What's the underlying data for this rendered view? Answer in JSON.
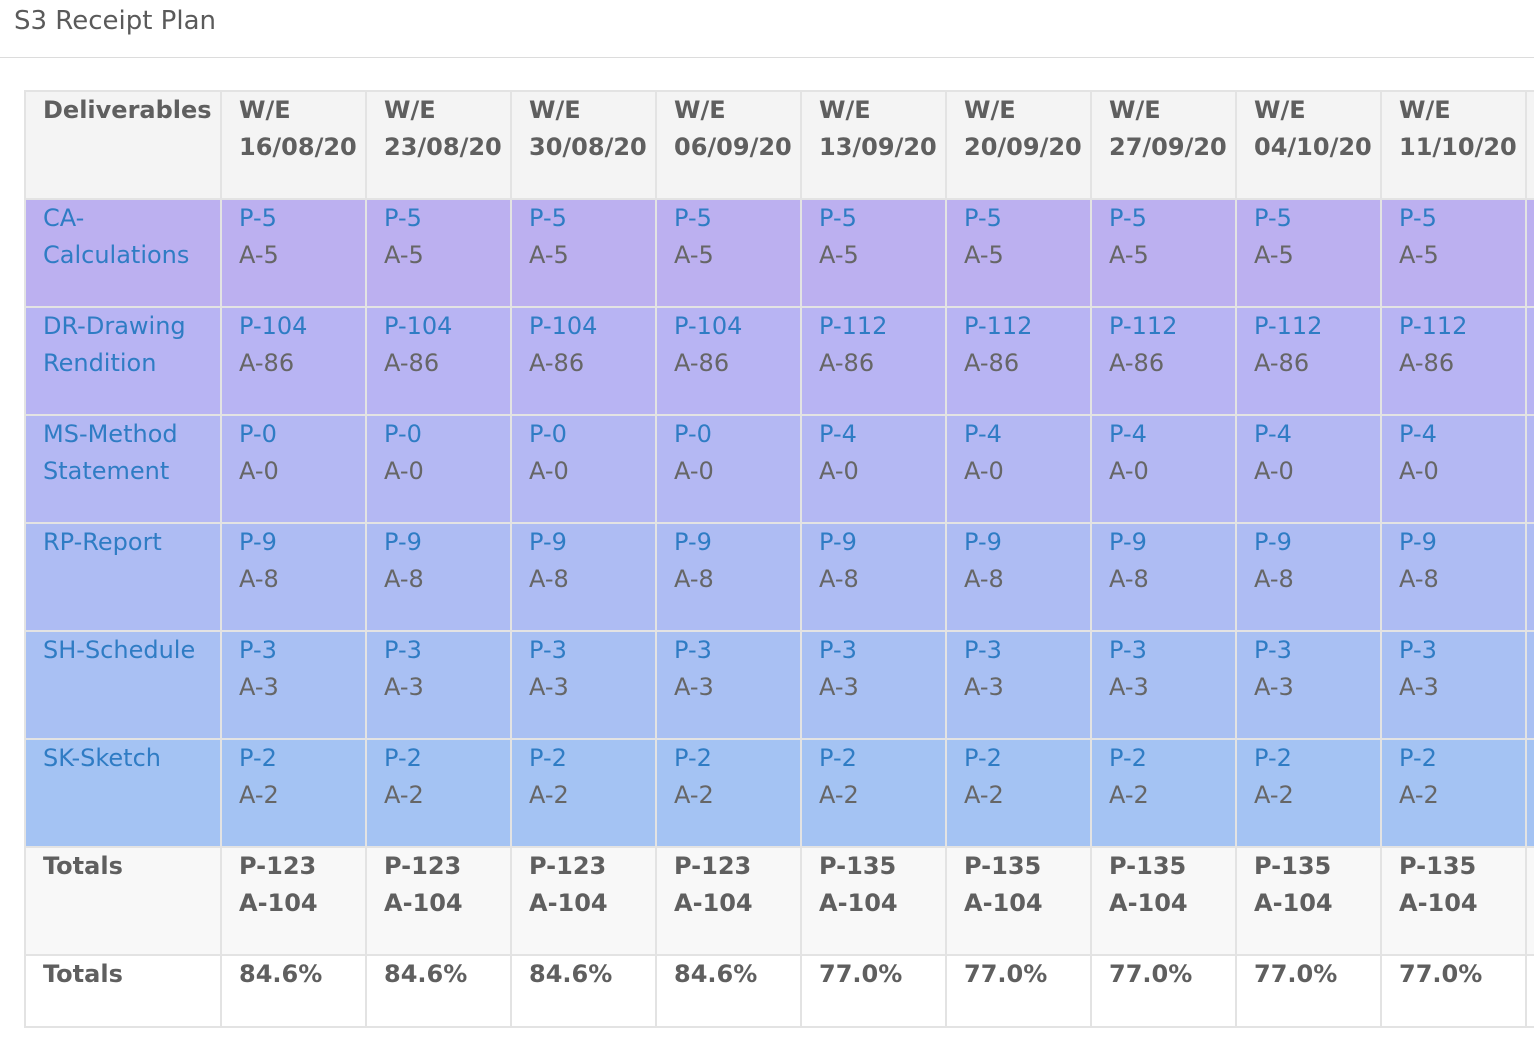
{
  "panel": {
    "title": "S3 Receipt Plan"
  },
  "colors": {
    "row_bg": [
      "#bcb0f0",
      "#b8b4f3",
      "#b4b8f3",
      "#aebcf3",
      "#a9c0f3",
      "#a4c3f3"
    ],
    "link_text": "#2f7cc4",
    "muted_text": "#666666"
  },
  "table": {
    "header_first": "Deliverables",
    "columns": [
      {
        "prefix": "W/E",
        "date": "16/08/20"
      },
      {
        "prefix": "W/E",
        "date": "23/08/20"
      },
      {
        "prefix": "W/E",
        "date": "30/08/20"
      },
      {
        "prefix": "W/E",
        "date": "06/09/20"
      },
      {
        "prefix": "W/E",
        "date": "13/09/20"
      },
      {
        "prefix": "W/E",
        "date": "20/09/20"
      },
      {
        "prefix": "W/E",
        "date": "27/09/20"
      },
      {
        "prefix": "W/E",
        "date": "04/10/20"
      },
      {
        "prefix": "W/E",
        "date": "11/10/20"
      }
    ],
    "rows": [
      {
        "name": "CA-Calculations",
        "cells": [
          {
            "p": "P-5",
            "a": "A-5"
          },
          {
            "p": "P-5",
            "a": "A-5"
          },
          {
            "p": "P-5",
            "a": "A-5"
          },
          {
            "p": "P-5",
            "a": "A-5"
          },
          {
            "p": "P-5",
            "a": "A-5"
          },
          {
            "p": "P-5",
            "a": "A-5"
          },
          {
            "p": "P-5",
            "a": "A-5"
          },
          {
            "p": "P-5",
            "a": "A-5"
          },
          {
            "p": "P-5",
            "a": "A-5"
          }
        ]
      },
      {
        "name": "DR-Drawing Rendition",
        "cells": [
          {
            "p": "P-104",
            "a": "A-86"
          },
          {
            "p": "P-104",
            "a": "A-86"
          },
          {
            "p": "P-104",
            "a": "A-86"
          },
          {
            "p": "P-104",
            "a": "A-86"
          },
          {
            "p": "P-112",
            "a": "A-86"
          },
          {
            "p": "P-112",
            "a": "A-86"
          },
          {
            "p": "P-112",
            "a": "A-86"
          },
          {
            "p": "P-112",
            "a": "A-86"
          },
          {
            "p": "P-112",
            "a": "A-86"
          }
        ]
      },
      {
        "name": "MS-Method Statement",
        "cells": [
          {
            "p": "P-0",
            "a": "A-0"
          },
          {
            "p": "P-0",
            "a": "A-0"
          },
          {
            "p": "P-0",
            "a": "A-0"
          },
          {
            "p": "P-0",
            "a": "A-0"
          },
          {
            "p": "P-4",
            "a": "A-0"
          },
          {
            "p": "P-4",
            "a": "A-0"
          },
          {
            "p": "P-4",
            "a": "A-0"
          },
          {
            "p": "P-4",
            "a": "A-0"
          },
          {
            "p": "P-4",
            "a": "A-0"
          }
        ]
      },
      {
        "name": "RP-Report",
        "cells": [
          {
            "p": "P-9",
            "a": "A-8"
          },
          {
            "p": "P-9",
            "a": "A-8"
          },
          {
            "p": "P-9",
            "a": "A-8"
          },
          {
            "p": "P-9",
            "a": "A-8"
          },
          {
            "p": "P-9",
            "a": "A-8"
          },
          {
            "p": "P-9",
            "a": "A-8"
          },
          {
            "p": "P-9",
            "a": "A-8"
          },
          {
            "p": "P-9",
            "a": "A-8"
          },
          {
            "p": "P-9",
            "a": "A-8"
          }
        ]
      },
      {
        "name": "SH-Schedule",
        "cells": [
          {
            "p": "P-3",
            "a": "A-3"
          },
          {
            "p": "P-3",
            "a": "A-3"
          },
          {
            "p": "P-3",
            "a": "A-3"
          },
          {
            "p": "P-3",
            "a": "A-3"
          },
          {
            "p": "P-3",
            "a": "A-3"
          },
          {
            "p": "P-3",
            "a": "A-3"
          },
          {
            "p": "P-3",
            "a": "A-3"
          },
          {
            "p": "P-3",
            "a": "A-3"
          },
          {
            "p": "P-3",
            "a": "A-3"
          }
        ]
      },
      {
        "name": "SK-Sketch",
        "cells": [
          {
            "p": "P-2",
            "a": "A-2"
          },
          {
            "p": "P-2",
            "a": "A-2"
          },
          {
            "p": "P-2",
            "a": "A-2"
          },
          {
            "p": "P-2",
            "a": "A-2"
          },
          {
            "p": "P-2",
            "a": "A-2"
          },
          {
            "p": "P-2",
            "a": "A-2"
          },
          {
            "p": "P-2",
            "a": "A-2"
          },
          {
            "p": "P-2",
            "a": "A-2"
          },
          {
            "p": "P-2",
            "a": "A-2"
          }
        ]
      }
    ],
    "totals": {
      "label": "Totals",
      "cells": [
        {
          "p": "P-123",
          "a": "A-104"
        },
        {
          "p": "P-123",
          "a": "A-104"
        },
        {
          "p": "P-123",
          "a": "A-104"
        },
        {
          "p": "P-123",
          "a": "A-104"
        },
        {
          "p": "P-135",
          "a": "A-104"
        },
        {
          "p": "P-135",
          "a": "A-104"
        },
        {
          "p": "P-135",
          "a": "A-104"
        },
        {
          "p": "P-135",
          "a": "A-104"
        },
        {
          "p": "P-135",
          "a": "A-104"
        }
      ]
    },
    "percent_totals": {
      "label": "Totals",
      "cells": [
        "84.6%",
        "84.6%",
        "84.6%",
        "84.6%",
        "77.0%",
        "77.0%",
        "77.0%",
        "77.0%",
        "77.0%"
      ]
    }
  }
}
